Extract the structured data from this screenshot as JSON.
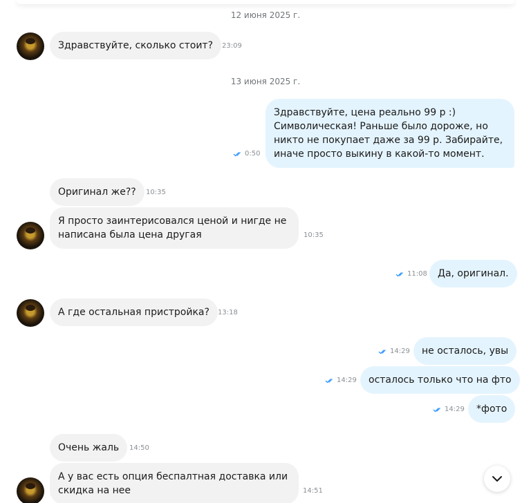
{
  "dates": [
    "12 июня 2025 г.",
    "13 июня 2025 г."
  ],
  "messages": [
    {
      "text": "Здравствуйте, сколько стоит?",
      "time": "23:09"
    },
    {
      "text": "Здравствуйте, цена реально 99 р :) Символическая! Раньше было дороже, но никто не покупает даже за 99 р. Забирайте, иначе просто выкину в какой-то момент.",
      "time": "0:50"
    },
    {
      "text": "Оригинал же??",
      "time": "10:35"
    },
    {
      "text": "Я просто заинтерисовался ценой и нигде не написана была цена другая",
      "time": "10:35"
    },
    {
      "text": "Да, оригинал.",
      "time": "11:08"
    },
    {
      "text": "А где остальная пристройка?",
      "time": "13:18"
    },
    {
      "text": "не осталось, увы",
      "time": "14:29"
    },
    {
      "text": "осталось только что на фто",
      "time": "14:29"
    },
    {
      "text": "*фото",
      "time": "14:29"
    },
    {
      "text": "Очень жаль",
      "time": "14:50"
    },
    {
      "text": "А у вас есть опция беспалтная доставка или скидка на нее",
      "time": "14:51"
    }
  ],
  "icons": {
    "read": "double-check-icon",
    "scroll": "chevron-down-icon"
  },
  "colors": {
    "incoming": "#f2f2f2",
    "outgoing": "#e4f4fe",
    "check": "#1a8cff"
  }
}
